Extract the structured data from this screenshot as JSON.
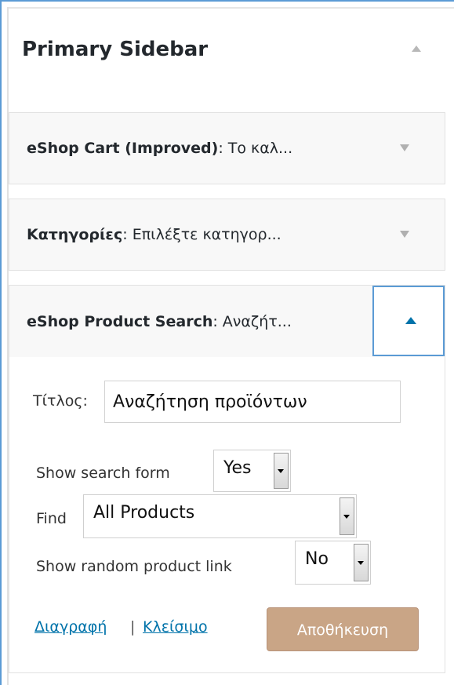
{
  "sidebar": {
    "title": "Primary Sidebar"
  },
  "widgets": [
    {
      "name": "eShop Cart (Improved)",
      "desc": ": Το καλ..."
    },
    {
      "name": "Κατηγορίες",
      "desc": ": Επιλέξτε κατηγορ..."
    },
    {
      "name": "eShop Product Search",
      "desc": ": Αναζήτ..."
    }
  ],
  "form": {
    "title_label": "Τίτλος:",
    "title_value": "Αναζήτηση προϊόντων",
    "show_search_label": "Show search form",
    "show_search_value": "Yes",
    "find_label": "Find",
    "find_value": "All Products",
    "random_label": "Show random product link",
    "random_value": "No"
  },
  "actions": {
    "delete_label": "Διαγραφή",
    "separator": "|",
    "close_label": "Κλείσιμο",
    "save_label": "Αποθήκευση"
  },
  "colors": {
    "accent": "#5b9bd5",
    "link": "#0073aa",
    "save_button": "#c9a586"
  }
}
